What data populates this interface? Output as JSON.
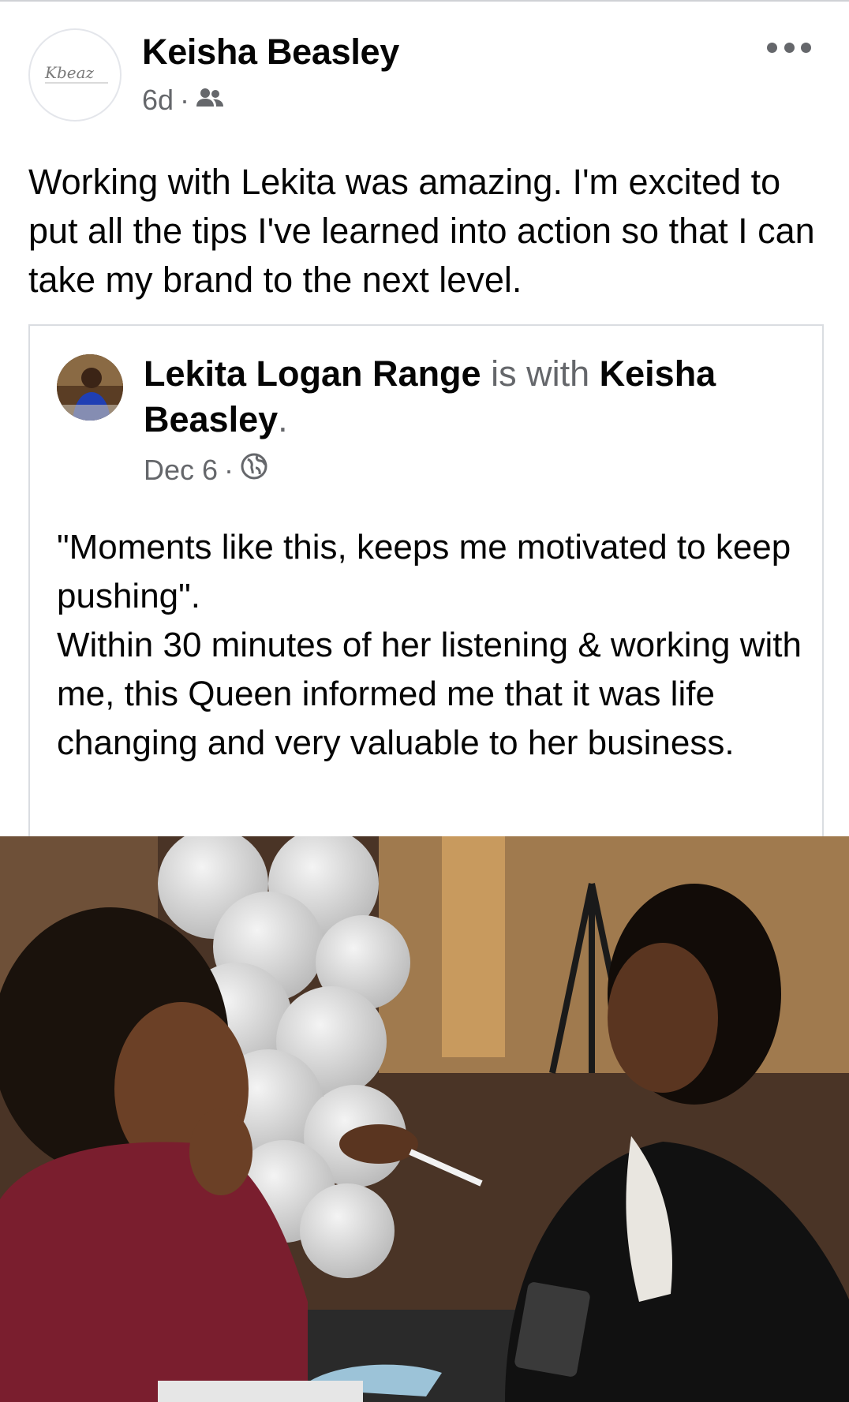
{
  "post": {
    "author": "Keisha Beasley",
    "time": "6d",
    "separator": "·",
    "audience_icon": "friends-icon",
    "more_icon": "more-options-icon",
    "text": "Working with Lekita was amazing. I'm excited to put all the tips I've learned into action so that I can take my brand to the next level.",
    "avatar_logo_text": "Kbeaz"
  },
  "shared": {
    "author": "Lekita Logan Range",
    "is_with": "is with",
    "with_name": "Keisha Beasley",
    "period": ".",
    "date": "Dec 6",
    "separator": "·",
    "audience_icon": "globe-icon",
    "text": "\"Moments like this, keeps me motivated to keep pushing\".\nWithin 30 minutes of her listening & working with me, this Queen informed me that it was life changing and very valuable to her business."
  },
  "colors": {
    "text": "#050505",
    "secondary": "#65676b",
    "border": "#dadde1"
  }
}
